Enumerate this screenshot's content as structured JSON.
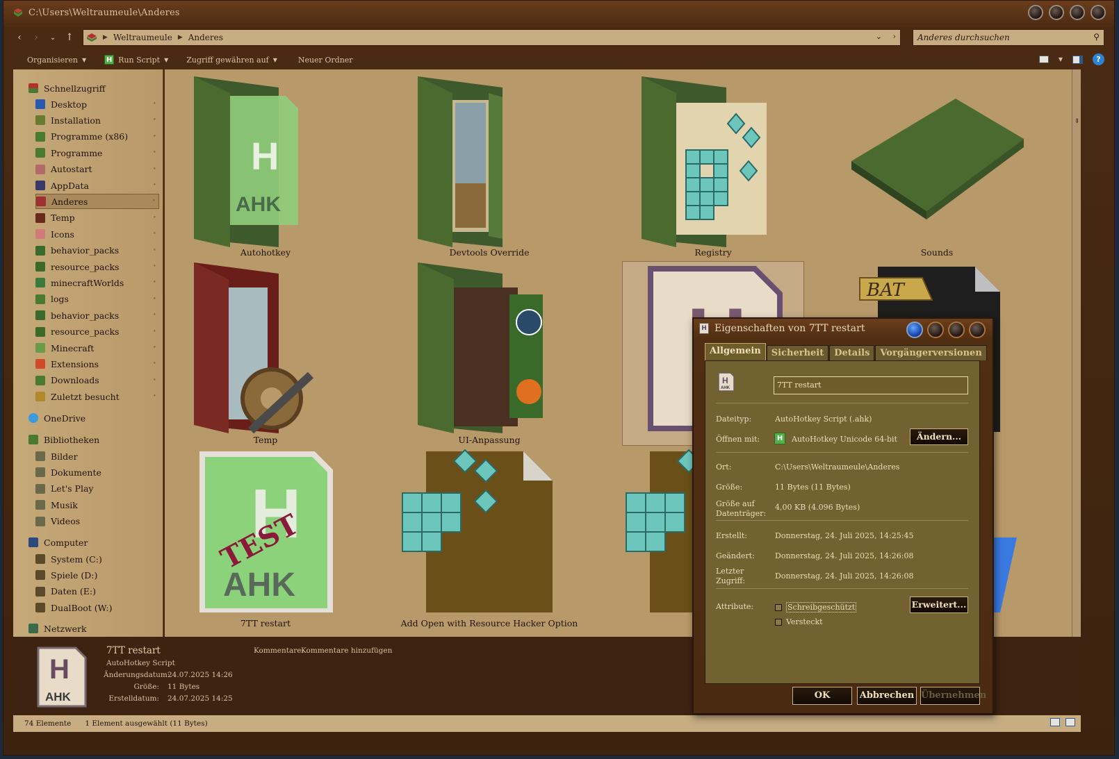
{
  "window": {
    "title": "C:\\Users\\Weltraumeule\\Anderes"
  },
  "nav": {
    "path": [
      "Weltraumeule",
      "Anderes"
    ],
    "search_placeholder": "Anderes durchsuchen"
  },
  "toolbar": {
    "organize": "Organisieren",
    "run_script": "Run Script",
    "share": "Zugriff gewähren auf",
    "new_folder": "Neuer Ordner"
  },
  "sidebar": {
    "quick_access": "Schnellzugriff",
    "quick_items": [
      "Desktop",
      "Installation",
      "Programme (x86)",
      "Programme",
      "Autostart",
      "AppData",
      "Anderes",
      "Temp",
      "Icons",
      "behavior_packs",
      "resource_packs",
      "minecraftWorlds",
      "logs",
      "behavior_packs",
      "resource_packs",
      "Minecraft",
      "Extensions",
      "Downloads",
      "Zuletzt besucht"
    ],
    "onedrive": "OneDrive",
    "libraries": "Bibliotheken",
    "library_items": [
      "Bilder",
      "Dokumente",
      "Let's Play",
      "Musik",
      "Videos"
    ],
    "computer": "Computer",
    "drives": [
      "System (C:)",
      "Spiele (D:)",
      "Daten (E:)",
      "DualBoot (W:)"
    ],
    "network": "Netzwerk",
    "icon_colors": [
      "#2a5ab0",
      "#6a7a30",
      "#4a7a30",
      "#4a7a30",
      "#b06a6a",
      "#3a3a6a",
      "#a03030",
      "#6a2a1a",
      "#d07a7a",
      "#3a6a2a",
      "#3a6a2a",
      "#3a7a3a",
      "#4a7a30",
      "#3a6a2a",
      "#3a6a2a",
      "#6a9a4a",
      "#d04a2a",
      "#4a7a30",
      "#b08a2a"
    ]
  },
  "files": [
    {
      "name": "Autohotkey",
      "icon": "ahk-folder-icon"
    },
    {
      "name": "Devtools Override",
      "icon": "landscape-folder-icon"
    },
    {
      "name": "Registry",
      "icon": "registry-folder-icon"
    },
    {
      "name": "Sounds",
      "icon": "flat-folder-icon"
    },
    {
      "name": "Temp",
      "icon": "temp-folder-icon"
    },
    {
      "name": "UI-Anpassung",
      "icon": "ui-folder-icon"
    },
    {
      "name": "7TT restart",
      "icon": "ahk-file-icon"
    },
    {
      "name": "",
      "icon": "bat-file-icon"
    },
    {
      "name": "7TT restart",
      "icon": "ahk-test-file-icon"
    },
    {
      "name": "Add Open with Resource Hacker Option",
      "icon": "reg-file-icon"
    },
    {
      "name": "",
      "icon": "reg-file-icon"
    }
  ],
  "details": {
    "name": "7TT restart",
    "type": "AutoHotkey Script",
    "modified_label": "Änderungsdatum:",
    "modified": "24.07.2025 14:26",
    "size_label": "Größe:",
    "size": "11 Bytes",
    "created_label": "Erstelldatum:",
    "created": "24.07.2025 14:25",
    "comments_label": "Kommentare:",
    "comments": "Kommentare hinzufügen"
  },
  "status": {
    "count": "74 Elemente",
    "selection": "1 Element ausgewählt (11 Bytes)"
  },
  "dialog": {
    "title": "Eigenschaften von 7TT restart",
    "tabs": [
      "Allgemein",
      "Sicherheit",
      "Details",
      "Vorgängerversionen"
    ],
    "filename": "7TT restart",
    "type_label": "Dateityp:",
    "type": "AutoHotkey Script (.ahk)",
    "opens_label": "Öffnen mit:",
    "opens": "AutoHotkey Unicode 64-bit",
    "change_button": "Ändern...",
    "location_label": "Ort:",
    "location": "C:\\Users\\Weltraumeule\\Anderes",
    "size_label": "Größe:",
    "size": "11 Bytes (11 Bytes)",
    "disk_size_label_1": "Größe auf",
    "disk_size_label_2": "Datenträger:",
    "disk_size": "4,00 KB (4.096 Bytes)",
    "created_label": "Erstellt:",
    "created": "Donnerstag, 24. Juli 2025, 14:25:45",
    "modified_label": "Geändert:",
    "modified": "Donnerstag, 24. Juli 2025, 14:26:08",
    "accessed_label_1": "Letzter",
    "accessed_label_2": "Zugriff:",
    "accessed": "Donnerstag, 24. Juli 2025, 14:26:08",
    "attributes_label": "Attribute:",
    "readonly": "Schreibgeschützt",
    "hidden": "Versteckt",
    "advanced_button": "Erweitert...",
    "ok": "OK",
    "cancel": "Abbrechen",
    "apply": "Übernehmen"
  }
}
